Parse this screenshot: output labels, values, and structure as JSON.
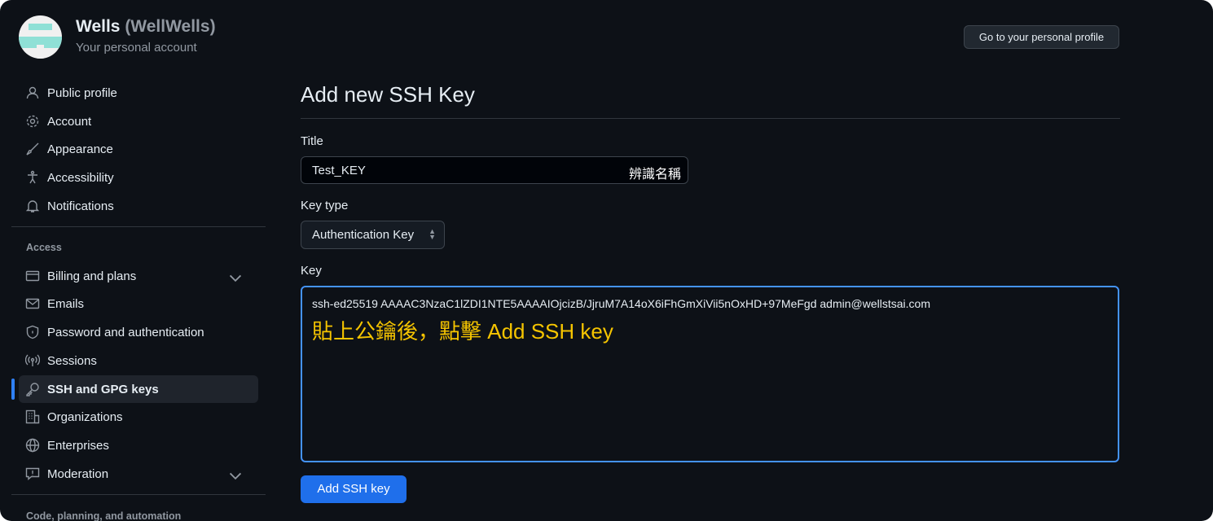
{
  "user": {
    "name": "Wells",
    "handle": "(WellWells)",
    "subtitle": "Your personal account"
  },
  "header": {
    "profile_button": "Go to your personal profile"
  },
  "sidebar": {
    "items": [
      {
        "label": "Public profile",
        "icon": "person-icon"
      },
      {
        "label": "Account",
        "icon": "gear-icon"
      },
      {
        "label": "Appearance",
        "icon": "paintbrush-icon"
      },
      {
        "label": "Accessibility",
        "icon": "accessibility-icon"
      },
      {
        "label": "Notifications",
        "icon": "bell-icon"
      }
    ],
    "access_heading": "Access",
    "access_items": [
      {
        "label": "Billing and plans",
        "icon": "credit-card-icon"
      },
      {
        "label": "Emails",
        "icon": "mail-icon"
      },
      {
        "label": "Password and authentication",
        "icon": "shield-lock-icon"
      },
      {
        "label": "Sessions",
        "icon": "broadcast-icon"
      },
      {
        "label": "SSH and GPG keys",
        "icon": "key-icon",
        "active": true
      },
      {
        "label": "Organizations",
        "icon": "organization-icon"
      },
      {
        "label": "Enterprises",
        "icon": "globe-icon"
      },
      {
        "label": "Moderation",
        "icon": "report-icon"
      }
    ],
    "code_heading": "Code, planning, and automation"
  },
  "form": {
    "heading": "Add new SSH Key",
    "title_label": "Title",
    "title_value": "Test_KEY",
    "title_annotation": "辨識名稱",
    "key_type_label": "Key type",
    "key_type_value": "Authentication Key",
    "key_label": "Key",
    "key_value": "ssh-ed25519 AAAAC3NzaC1lZDI1NTE5AAAAIOjcizB/JjruM7A14oX6iFhGmXiVii5nOxHD+97MeFgd admin@wellstsai.com",
    "key_annotation": "貼上公鑰後，點擊 Add SSH key",
    "submit": "Add SSH key"
  },
  "colors": {
    "accent": "#1f6feb",
    "focus": "#4493f8",
    "annotation": "#f5c400",
    "background": "#0d1117"
  }
}
